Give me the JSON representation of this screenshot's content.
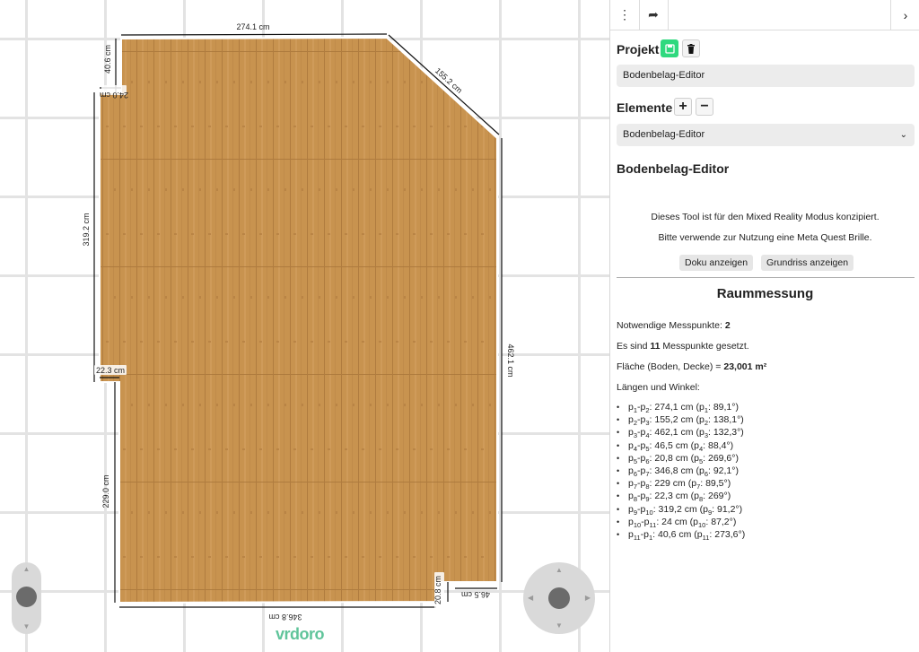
{
  "canvas": {
    "dimensions": {
      "top": "274.1 cm",
      "diagonal": "155.2 cm",
      "right": "462.1 cm",
      "bottom_small": "46.5 cm",
      "bottom_step": "20.8 cm",
      "bottom": "346.8 cm",
      "left_lower": "229.0 cm",
      "notch_lower": "22.3 cm",
      "left_upper": "319.2 cm",
      "notch_upper": "24.0 cm",
      "top_left": "40.6 cm"
    },
    "logo": "vrdoro",
    "colors": {
      "floor": "#c8934f",
      "grid": "#e3e3e3",
      "logo": "#5fc49a"
    }
  },
  "panel": {
    "toolbar": {
      "menu_icon": "⋮",
      "share_icon": "➦",
      "collapse_icon": "›"
    },
    "projekt": {
      "label": "Projekt",
      "name": "Bodenbelag-Editor",
      "save_icon": "save-icon",
      "delete_icon": "trash-icon"
    },
    "elemente": {
      "label": "Elemente",
      "selected": "Bodenbelag-Editor"
    },
    "editor_title": "Bodenbelag-Editor",
    "info_line1": "Dieses Tool ist für den Mixed Reality Modus konzipiert.",
    "info_line2": "Bitte verwende zur Nutzung eine Meta Quest Brille.",
    "btn_doku": "Doku anzeigen",
    "btn_grundriss": "Grundriss anzeigen",
    "raummessung": {
      "title": "Raummessung",
      "needed_label": "Notwendige Messpunkte: ",
      "needed_value": "2",
      "set_prefix": "Es sind ",
      "set_value": "11",
      "set_suffix": " Messpunkte gesetzt.",
      "area_label": "Fläche (Boden, Decke) = ",
      "area_value": "23,001 m²",
      "lengths_label": "Längen und Winkel:",
      "items": [
        {
          "a": "1",
          "b": "2",
          "len": "274,1 cm",
          "pt": "1",
          "ang": "89,1°"
        },
        {
          "a": "2",
          "b": "3",
          "len": "155,2 cm",
          "pt": "2",
          "ang": "138,1°"
        },
        {
          "a": "3",
          "b": "4",
          "len": "462,1 cm",
          "pt": "3",
          "ang": "132,3°"
        },
        {
          "a": "4",
          "b": "5",
          "len": "46,5 cm",
          "pt": "4",
          "ang": "88,4°"
        },
        {
          "a": "5",
          "b": "6",
          "len": "20,8 cm",
          "pt": "5",
          "ang": "269,6°"
        },
        {
          "a": "6",
          "b": "7",
          "len": "346,8 cm",
          "pt": "6",
          "ang": "92,1°"
        },
        {
          "a": "7",
          "b": "8",
          "len": "229 cm",
          "pt": "7",
          "ang": "89,5°"
        },
        {
          "a": "8",
          "b": "9",
          "len": "22,3 cm",
          "pt": "8",
          "ang": "269°"
        },
        {
          "a": "9",
          "b": "10",
          "len": "319,2 cm",
          "pt": "9",
          "ang": "91,2°"
        },
        {
          "a": "10",
          "b": "11",
          "len": "24 cm",
          "pt": "10",
          "ang": "87,2°"
        },
        {
          "a": "11",
          "b": "1",
          "len": "40,6 cm",
          "pt": "11",
          "ang": "273,6°"
        }
      ]
    }
  }
}
